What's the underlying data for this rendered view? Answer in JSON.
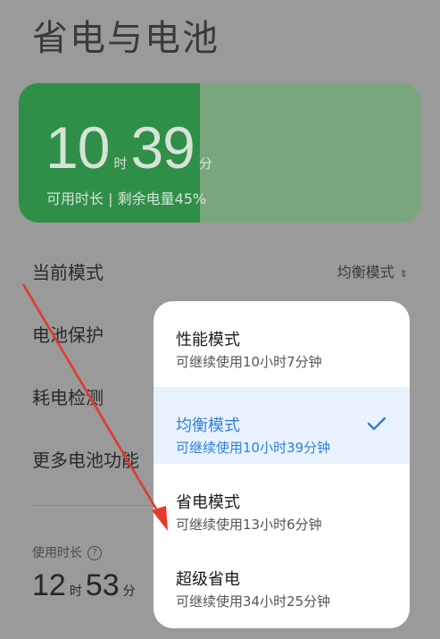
{
  "header": {
    "title": "省电与电池"
  },
  "battery": {
    "hours": "10",
    "hours_unit": "时",
    "minutes": "39",
    "minutes_unit": "分",
    "subtitle": "可用时长 | 剩余电量45%",
    "level_percent": 45
  },
  "settings": {
    "current_mode_label": "当前模式",
    "current_mode_value": "均衡模式",
    "battery_protect_label": "电池保护",
    "consumption_check_label": "耗电检测",
    "more_label": "更多电池功能"
  },
  "usage": {
    "label": "使用时长",
    "hours": "12",
    "hours_unit": "时",
    "minutes": "53",
    "minutes_unit": "分"
  },
  "mode_menu": {
    "options": [
      {
        "title": "性能模式",
        "subtitle": "可继续使用10小时7分钟",
        "selected": false
      },
      {
        "title": "均衡模式",
        "subtitle": "可继续使用10小时39分钟",
        "selected": true
      },
      {
        "title": "省电模式",
        "subtitle": "可继续使用13小时6分钟",
        "selected": false
      },
      {
        "title": "超级省电",
        "subtitle": "可继续使用34小时25分钟",
        "selected": false
      }
    ]
  },
  "colors": {
    "accent": "#2f7fe0",
    "battery_fill": "#2f8f48",
    "annotation_arrow": "#e23a2c"
  }
}
